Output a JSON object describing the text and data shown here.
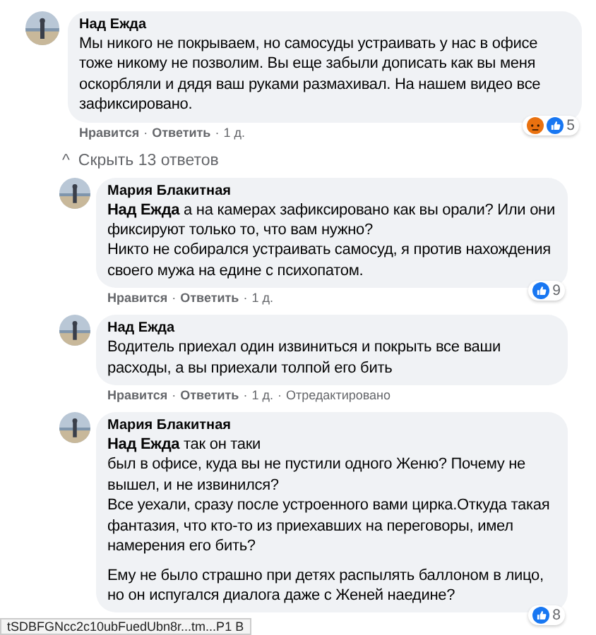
{
  "comment": {
    "author": "Над Ежда",
    "paragraphs": [
      [
        "Мы никого не покрываем, но самосуды устраивать у нас в офисе тоже никому не позволим. Вы еще забыли дописать как вы меня оскорбляли и дядя ваш руками размахивал. На нашем видео все зафиксировано."
      ]
    ],
    "reactions": {
      "icons": [
        {
          "kind": "angry"
        },
        {
          "kind": "like"
        }
      ],
      "count": "5"
    },
    "actions": [
      {
        "kind": "link",
        "text": "Нравится"
      },
      {
        "kind": "sep",
        "text": "·"
      },
      {
        "kind": "link",
        "text": "Ответить"
      },
      {
        "kind": "sep",
        "text": "·"
      },
      {
        "kind": "meta",
        "text": "1 д."
      }
    ]
  },
  "replies_toggle": {
    "icon": "^",
    "label": "Скрыть 13 ответов"
  },
  "replies": [
    {
      "author": "Мария Блакитная",
      "paragraphs": [
        [
          "**Над Ежда** а на камерах зафиксировано как вы орали? Или они фиксируют только то, что вам нужно?",
          "Никто не собирался устраивать самосуд, я против нахождения своего мужа на едине с психопатом."
        ]
      ],
      "reactions": {
        "icons": [
          {
            "kind": "like"
          }
        ],
        "count": "9"
      },
      "actions": [
        {
          "kind": "link",
          "text": "Нравится"
        },
        {
          "kind": "sep",
          "text": "·"
        },
        {
          "kind": "link",
          "text": "Ответить"
        },
        {
          "kind": "sep",
          "text": "·"
        },
        {
          "kind": "meta",
          "text": "1 д."
        }
      ]
    },
    {
      "author": "Над Ежда",
      "paragraphs": [
        [
          "Водитель приехал один извиниться и покрыть все ваши расходы, а вы приехали толпой его бить"
        ]
      ],
      "actions": [
        {
          "kind": "link",
          "text": "Нравится"
        },
        {
          "kind": "sep",
          "text": "·"
        },
        {
          "kind": "link",
          "text": "Ответить"
        },
        {
          "kind": "sep",
          "text": "·"
        },
        {
          "kind": "meta",
          "text": "1 д."
        },
        {
          "kind": "sep",
          "text": "·"
        },
        {
          "kind": "meta",
          "text": "Отредактировано"
        }
      ]
    },
    {
      "author": "Мария Блакитная",
      "paragraphs": [
        [
          "**Над Ежда** так он таки",
          "был в офисе, куда вы не пустили одного Женю? Почему не вышел, и не извинился?",
          "Все уехали, сразу после устроенного вами цирка.Откуда такая фантазия, что кто-то из приехавших на переговоры, имел намерения его бить?"
        ],
        [
          "Ему не было страшно при детях распылять баллоном в лицо, но он испугался диалога даже с Женей наедине?"
        ]
      ],
      "reactions": {
        "icons": [
          {
            "kind": "like"
          }
        ],
        "count": "8"
      }
    }
  ],
  "status_url": "tSDBFGNcc2c10ubFuedUbn8r...tm...P1 B"
}
